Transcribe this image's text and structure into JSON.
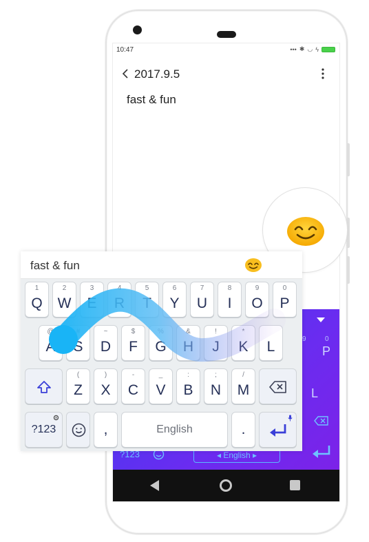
{
  "status": {
    "time": "10:47"
  },
  "note": {
    "date": "2017.9.5",
    "body": "fast & fun"
  },
  "keyboard": {
    "suggestion": "fast & fun",
    "row1": [
      {
        "hint": "1",
        "key": "Q"
      },
      {
        "hint": "2",
        "key": "W"
      },
      {
        "hint": "3",
        "key": "E"
      },
      {
        "hint": "4",
        "key": "R"
      },
      {
        "hint": "5",
        "key": "T"
      },
      {
        "hint": "6",
        "key": "Y"
      },
      {
        "hint": "7",
        "key": "U"
      },
      {
        "hint": "8",
        "key": "I"
      },
      {
        "hint": "9",
        "key": "O"
      },
      {
        "hint": "0",
        "key": "P"
      }
    ],
    "row2": [
      {
        "hint": "@",
        "key": "A"
      },
      {
        "hint": "#",
        "key": "S"
      },
      {
        "hint": "~",
        "key": "D"
      },
      {
        "hint": "$",
        "key": "F"
      },
      {
        "hint": "%",
        "key": "G"
      },
      {
        "hint": "&",
        "key": "H"
      },
      {
        "hint": "!",
        "key": "J"
      },
      {
        "hint": "*",
        "key": "K"
      },
      {
        "hint": "",
        "key": "L"
      }
    ],
    "row3": [
      {
        "hint": "(",
        "key": "Z"
      },
      {
        "hint": ")",
        "key": "X"
      },
      {
        "hint": "-",
        "key": "C"
      },
      {
        "hint": "_",
        "key": "V"
      },
      {
        "hint": ":",
        "key": "B"
      },
      {
        "hint": ";",
        "key": "N"
      },
      {
        "hint": "/",
        "key": "M"
      }
    ],
    "sym_label": "?123",
    "comma": ",",
    "space_label": "English",
    "period": "."
  },
  "bg_keyboard": {
    "sym_label": "?123",
    "space_label": "English",
    "p_hint": "0",
    "o_hint": "9",
    "p_key": "P",
    "l_key": "L"
  },
  "colors": {
    "key_text": "#253057",
    "accent": "#3a3fd8",
    "swipe_start": "#1ab3f5",
    "swipe_end": "#a77ee8"
  }
}
